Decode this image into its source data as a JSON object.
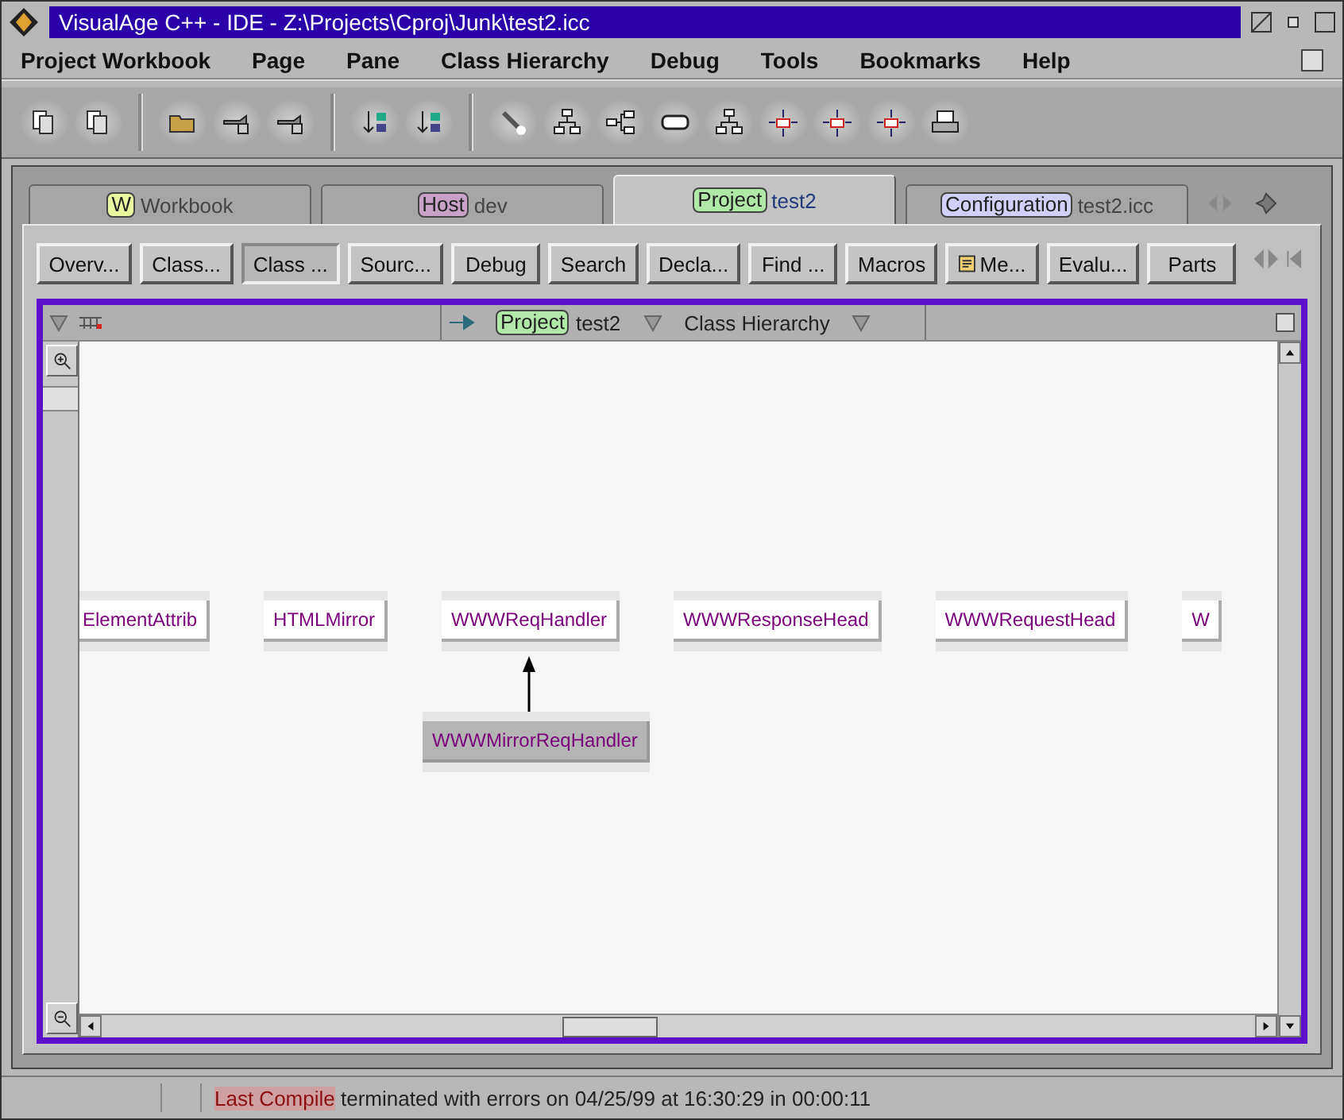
{
  "window": {
    "title": "VisualAge C++ - IDE - Z:\\Projects\\Cproj\\Junk\\test2.icc"
  },
  "menu": [
    "Project Workbook",
    "Page",
    "Pane",
    "Class Hierarchy",
    "Debug",
    "Tools",
    "Bookmarks",
    "Help"
  ],
  "tabs": [
    {
      "badge": "W",
      "color": "#e8f8a0",
      "label": "Workbook",
      "selected": false
    },
    {
      "badge": "Host",
      "color": "#c8a0c8",
      "label": "dev",
      "selected": false
    },
    {
      "badge": "Project",
      "color": "#b0e8a8",
      "label": "test2",
      "selected": true
    },
    {
      "badge": "Configuration",
      "color": "#d0d0f8",
      "label": "test2.icc",
      "selected": false
    }
  ],
  "page_buttons": [
    {
      "label": "Overv...",
      "selected": false
    },
    {
      "label": "Class...",
      "selected": false
    },
    {
      "label": "Class ...",
      "selected": true
    },
    {
      "label": "Sourc...",
      "selected": false
    },
    {
      "label": "Debug",
      "selected": false
    },
    {
      "label": "Search",
      "selected": false
    },
    {
      "label": "Decla...",
      "selected": false
    },
    {
      "label": "Find ...",
      "selected": false
    },
    {
      "label": "Macros",
      "selected": false
    },
    {
      "label": "Me...",
      "selected": false,
      "kind": "icon"
    },
    {
      "label": "Evalu...",
      "selected": false
    },
    {
      "label": "Parts",
      "selected": false
    }
  ],
  "pane": {
    "badge": "Project",
    "color": "#b0e8a8",
    "project": "test2",
    "view": "Class Hierarchy"
  },
  "zoom_slider": {
    "level": 1
  },
  "nodes": [
    {
      "label": "ElementAttrib",
      "selected": false
    },
    {
      "label": "HTMLMirror",
      "selected": false
    },
    {
      "label": "WWWReqHandler",
      "selected": false,
      "children": [
        {
          "label": "WWWMirrorReqHandler",
          "selected": true
        }
      ]
    },
    {
      "label": "WWWResponseHead",
      "selected": false
    },
    {
      "label": "WWWRequestHead",
      "selected": false
    },
    {
      "label": "W",
      "selected": false
    }
  ],
  "status_bar": {
    "highlight": "Last Compile",
    "message": "terminated with errors on 04/25/99 at 16:30:29 in 00:00:11"
  }
}
